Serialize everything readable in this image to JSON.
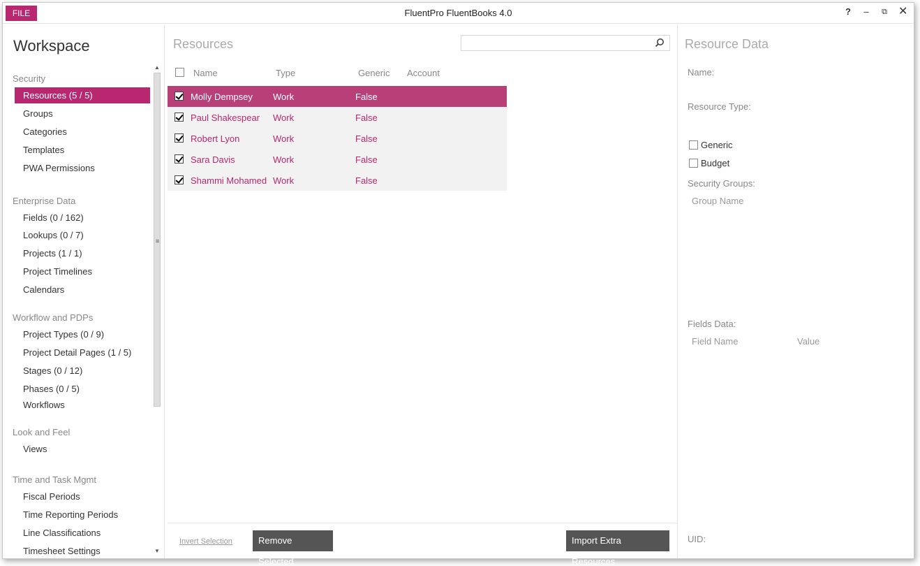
{
  "titlebar": {
    "file_label": "FILE",
    "app_title": "FluentPro FluentBooks 4.0",
    "help": "?",
    "minimize": "–",
    "restore": "⧉",
    "close": "✕"
  },
  "sidebar": {
    "title": "Workspace",
    "sections": [
      {
        "heading": "Security",
        "items": [
          "Resources (5 / 5)",
          "Groups",
          "Categories",
          "Templates",
          "PWA Permissions"
        ]
      },
      {
        "heading": "Enterprise Data",
        "items": [
          "Fields (0 / 162)",
          "Lookups (0 / 7)",
          "Projects (1 / 1)",
          "Project Timelines",
          "Calendars"
        ]
      },
      {
        "heading": "Workflow and PDPs",
        "items": [
          "Project Types (0 / 9)",
          "Project Detail Pages (1 / 5)",
          "Stages (0 / 12)",
          "Phases (0 / 5)",
          "Workflows"
        ]
      },
      {
        "heading": "Look and Feel",
        "items": [
          "Views"
        ]
      },
      {
        "heading": "Time and Task Mgmt",
        "items": [
          "Fiscal Periods",
          "Time Reporting Periods",
          "Line Classifications",
          "Timesheet Settings"
        ]
      }
    ],
    "active_item": "Resources (5 / 5)"
  },
  "resources": {
    "title": "Resources",
    "search_value": "",
    "columns": [
      "Name",
      "Type",
      "Generic",
      "Account"
    ],
    "rows": [
      {
        "name": "Molly Dempsey",
        "type": "Work",
        "generic": "False",
        "account": "",
        "checked": true,
        "selected": true
      },
      {
        "name": "Paul Shakespear",
        "type": "Work",
        "generic": "False",
        "account": "",
        "checked": true,
        "selected": false
      },
      {
        "name": "Robert Lyon",
        "type": "Work",
        "generic": "False",
        "account": "",
        "checked": true,
        "selected": false
      },
      {
        "name": "Sara Davis",
        "type": "Work",
        "generic": "False",
        "account": "",
        "checked": true,
        "selected": false
      },
      {
        "name": "Shammi Mohamed",
        "type": "Work",
        "generic": "False",
        "account": "",
        "checked": true,
        "selected": false
      }
    ],
    "invert_selection": "Invert Selection",
    "remove_selected": "Remove Selected",
    "import_extra": "Import Extra Resources"
  },
  "resource_data": {
    "title": "Resource Data",
    "name_label": "Name:",
    "type_label": "Resource Type:",
    "generic_label": "Generic",
    "budget_label": "Budget",
    "security_groups_label": "Security Groups:",
    "group_name_col": "Group Name",
    "fields_data_label": "Fields Data:",
    "field_name_col": "Field Name",
    "value_col": "Value",
    "uid_label": "UID:"
  },
  "colors": {
    "accent": "#b8276f",
    "selected_row": "#b93f78",
    "button_dark": "#555555"
  }
}
